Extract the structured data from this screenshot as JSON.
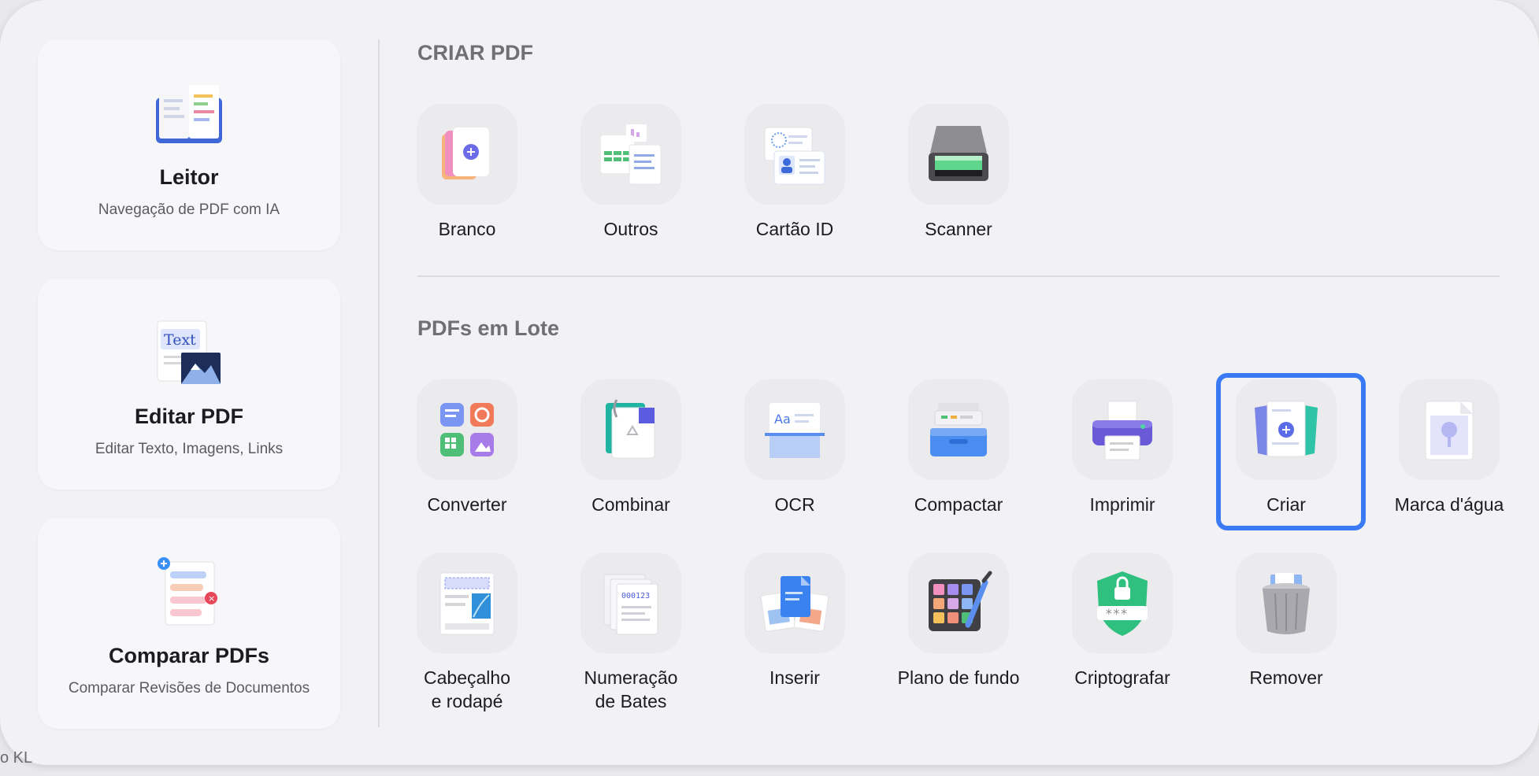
{
  "features": [
    {
      "title": "Leitor",
      "subtitle": "Navegação de PDF com IA"
    },
    {
      "title": "Editar PDF",
      "subtitle": "Editar Texto, Imagens, Links",
      "art_text": "Text"
    },
    {
      "title": "Comparar PDFs",
      "subtitle": "Comparar Revisões de Documentos"
    }
  ],
  "create_section": {
    "title": "CRIAR PDF",
    "tools": [
      {
        "label": "Branco",
        "icon": "blank-page-icon"
      },
      {
        "label": "Outros",
        "icon": "other-formats-icon"
      },
      {
        "label": "Cartão ID",
        "icon": "id-card-icon"
      },
      {
        "label": "Scanner",
        "icon": "scanner-icon"
      }
    ]
  },
  "batch_section": {
    "title": "PDFs em Lote",
    "tools": [
      {
        "label": "Converter",
        "icon": "convert-icon"
      },
      {
        "label": "Combinar",
        "icon": "combine-icon"
      },
      {
        "label": "OCR",
        "icon": "ocr-icon",
        "glyph": "Aa"
      },
      {
        "label": "Compactar",
        "icon": "compress-icon"
      },
      {
        "label": "Imprimir",
        "icon": "printer-icon"
      },
      {
        "label": "Criar",
        "icon": "create-icon",
        "selected": true
      },
      {
        "label": "Marca d'água",
        "icon": "watermark-icon"
      },
      {
        "label": "Cabeçalho e rodapé",
        "line1": "Cabeçalho",
        "line2": "e rodapé",
        "icon": "header-footer-icon"
      },
      {
        "label": "Numeração de Bates",
        "line1": "Numeração",
        "line2": "de Bates",
        "icon": "bates-numbering-icon",
        "glyph": "000123"
      },
      {
        "label": "Inserir",
        "icon": "insert-icon"
      },
      {
        "label": "Plano de fundo",
        "icon": "background-icon"
      },
      {
        "label": "Criptografar",
        "icon": "encrypt-icon",
        "glyph": "***"
      },
      {
        "label": "Remover",
        "icon": "trash-icon"
      }
    ]
  },
  "corner_text": "o KL",
  "colors": {
    "accent": "#3a7bf5",
    "panel": "#f2f2f4",
    "tile": "#ebebed"
  }
}
